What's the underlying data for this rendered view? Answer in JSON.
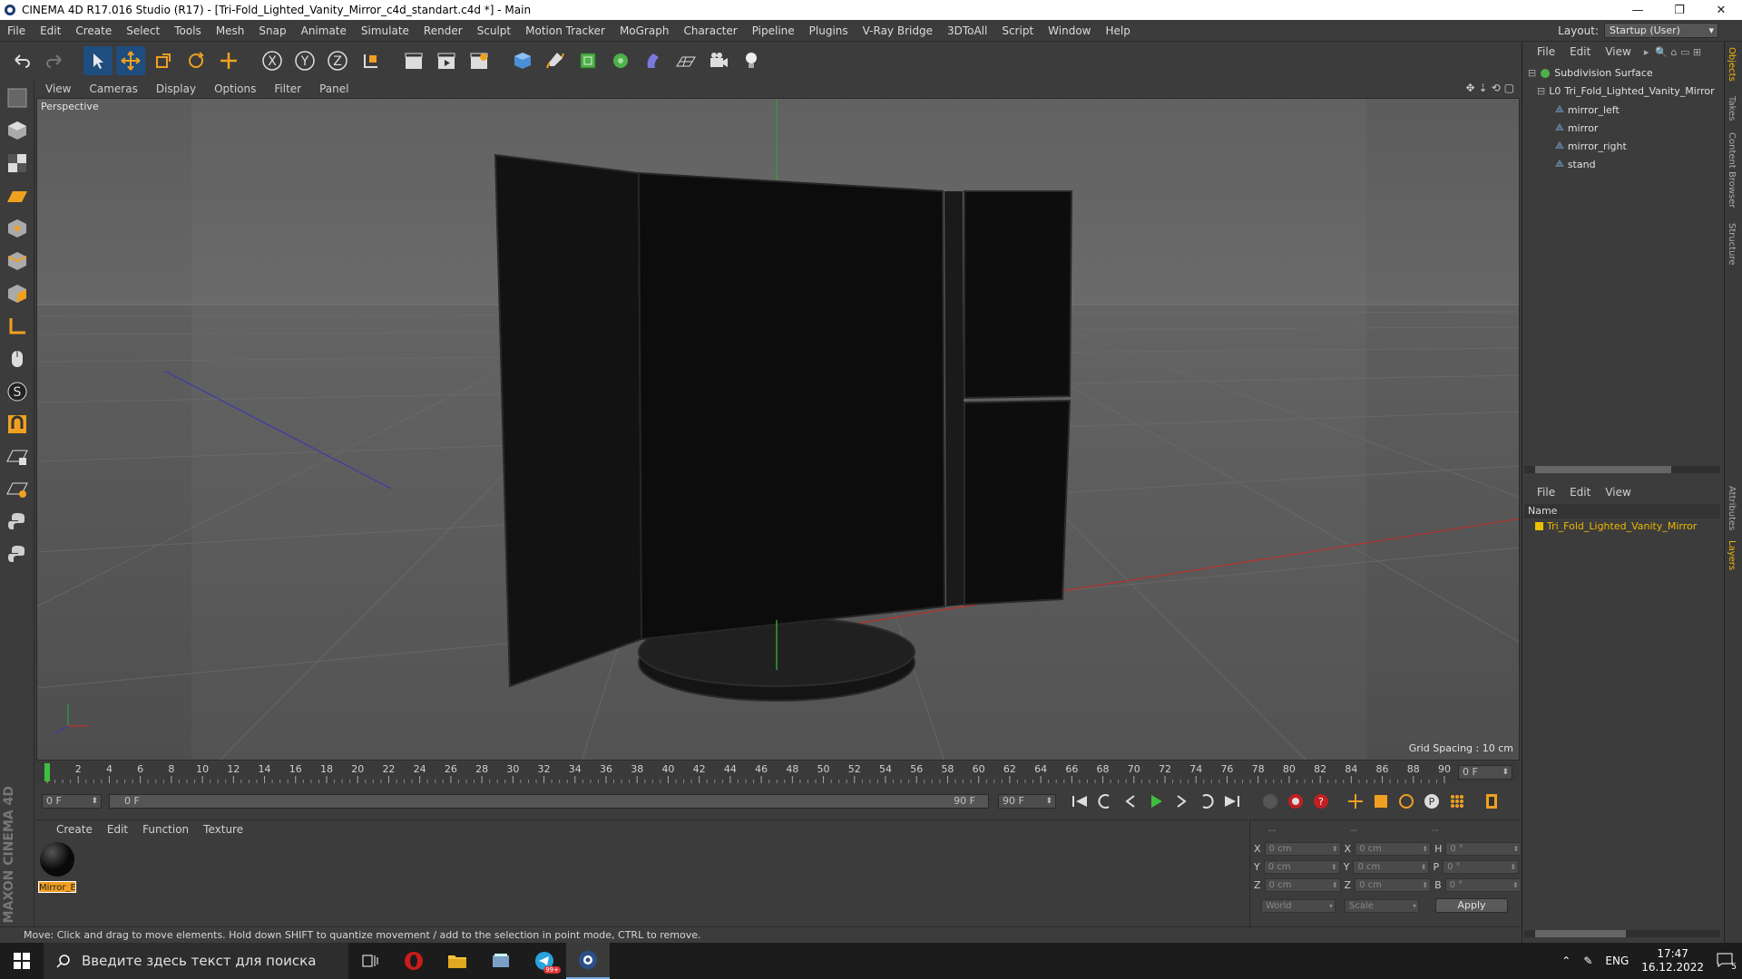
{
  "window": {
    "title": "CINEMA 4D R17.016 Studio (R17) - [Tri-Fold_Lighted_Vanity_Mirror_c4d_standart.c4d *] - Main",
    "controls": [
      "minimize",
      "maximize",
      "close"
    ]
  },
  "menu": [
    "File",
    "Edit",
    "Create",
    "Select",
    "Tools",
    "Mesh",
    "Snap",
    "Animate",
    "Simulate",
    "Render",
    "Sculpt",
    "Motion Tracker",
    "MoGraph",
    "Character",
    "Pipeline",
    "Plugins",
    "V-Ray Bridge",
    "3DToAll",
    "Script",
    "Window",
    "Help"
  ],
  "layout": {
    "label": "Layout:",
    "value": "Startup (User)"
  },
  "viewport": {
    "menu": [
      "View",
      "Cameras",
      "Display",
      "Options",
      "Filter",
      "Panel"
    ],
    "label": "Perspective",
    "grid_spacing": "Grid Spacing : 10 cm"
  },
  "timeline": {
    "ticks": [
      "0",
      "2",
      "4",
      "6",
      "8",
      "10",
      "12",
      "14",
      "16",
      "18",
      "20",
      "22",
      "24",
      "26",
      "28",
      "30",
      "32",
      "34",
      "36",
      "38",
      "40",
      "42",
      "44",
      "46",
      "48",
      "50",
      "52",
      "54",
      "56",
      "58",
      "60",
      "62",
      "64",
      "66",
      "68",
      "70",
      "72",
      "74",
      "76",
      "78",
      "80",
      "82",
      "84",
      "86",
      "88",
      "90"
    ],
    "current_frame": "0 F"
  },
  "frames": {
    "start": "0 F",
    "range_start": "0 F",
    "range_end": "90 F",
    "end": "90 F"
  },
  "material": {
    "menu": [
      "Create",
      "Edit",
      "Function",
      "Texture"
    ],
    "item": "Mirror_E"
  },
  "coords": {
    "header": [
      "--",
      "--",
      "--"
    ],
    "rows": [
      [
        "X",
        "0 cm",
        "X",
        "0 cm",
        "H",
        "0 °"
      ],
      [
        "Y",
        "0 cm",
        "Y",
        "0 cm",
        "P",
        "0 °"
      ],
      [
        "Z",
        "0 cm",
        "Z",
        "0 cm",
        "B",
        "0 °"
      ]
    ],
    "mode1": "World",
    "mode2": "Scale",
    "apply": "Apply"
  },
  "objects": {
    "menu": [
      "File",
      "Edit",
      "View"
    ],
    "tree": [
      "Subdivision Surface",
      "Tri_Fold_Lighted_Vanity_Mirror",
      "mirror_left",
      "mirror",
      "mirror_right",
      "stand"
    ]
  },
  "layers": {
    "menu": [
      "File",
      "Edit",
      "View"
    ],
    "header": "Name",
    "item": "Tri_Fold_Lighted_Vanity_Mirror"
  },
  "sidetabs": [
    "Objects",
    "Takes",
    "Content Browser",
    "Structure",
    "Attributes",
    "Layers"
  ],
  "status": "Move: Click and drag to move elements. Hold down SHIFT to quantize movement / add to the selection in point mode, CTRL to remove.",
  "brand": "MAXON CINEMA 4D",
  "taskbar": {
    "search": "Введите здесь текст для поиска",
    "lang": "ENG",
    "time": "17:47",
    "date": "16.12.2022",
    "badge": "99+",
    "notif": "5"
  },
  "colors": {
    "accent": "#1f4d80",
    "selected_text": "#f0b800",
    "bg": "#3c3c3c"
  }
}
